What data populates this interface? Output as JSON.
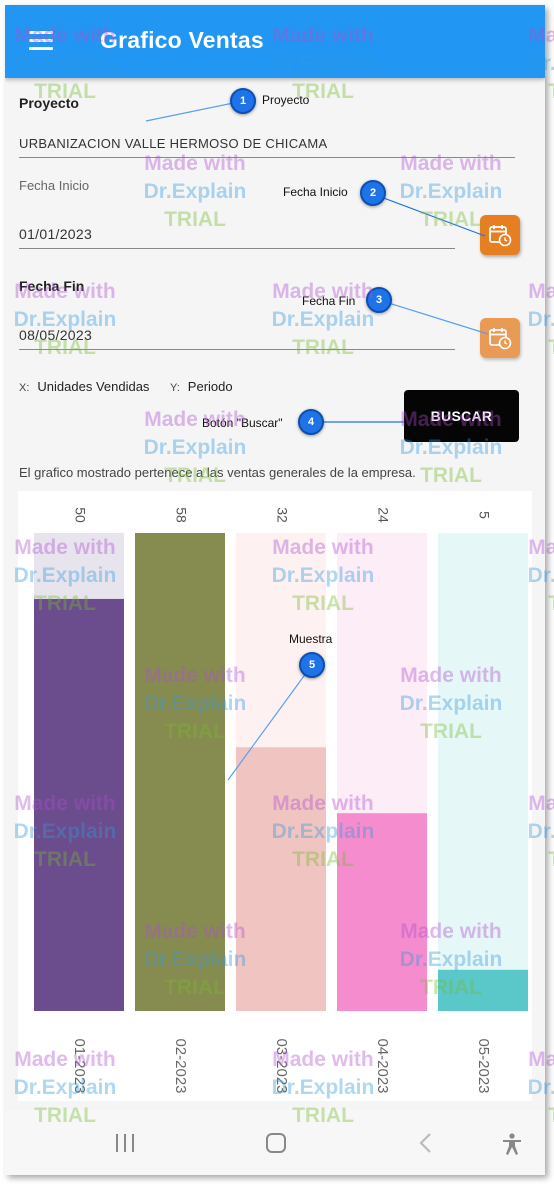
{
  "app": {
    "title": "Grafico Ventas"
  },
  "form": {
    "project_label": "Proyecto",
    "project_value": "URBANIZACION VALLE HERMOSO DE CHICAMA",
    "start_label": "Fecha Inicio",
    "start_value": "01/01/2023",
    "end_label": "Fecha Fin",
    "end_value": "08/05/2023",
    "x_mark": "X:",
    "x_value": "Unidades Vendidas",
    "y_mark": "Y:",
    "y_value": "Periodo",
    "search_label": "BUSCAR",
    "description": "El grafico mostrado pertenece a las ventas generales de la empresa."
  },
  "callouts": [
    {
      "number": "1",
      "text": "Proyecto"
    },
    {
      "number": "2",
      "text": "Fecha Inicio"
    },
    {
      "number": "3",
      "text": "Fecha Fin"
    },
    {
      "number": "4",
      "text": "Botón \"Buscar\""
    },
    {
      "number": "5",
      "text": "Muestra"
    }
  ],
  "watermark": {
    "line1": "Made with",
    "line2": "Dr.Explain",
    "line3": "TRIAL"
  },
  "icons": {
    "menu": "hamburger-menu-icon",
    "calendar": "calendar-clock-icon",
    "nav_recent": "recent-apps-icon",
    "nav_home": "home-icon",
    "nav_back": "back-icon",
    "nav_access": "accessibility-icon"
  },
  "colors": {
    "appbar": "#2196f3",
    "calendar_button": "#e67e22",
    "search_button": "#050505"
  },
  "chart_data": {
    "type": "bar",
    "categories": [
      "01-2023",
      "02-2023",
      "03-2023",
      "04-2023",
      "05-2023"
    ],
    "values": [
      50,
      58,
      32,
      24,
      5
    ],
    "ylim": [
      0,
      58
    ],
    "colors": [
      "#6b4c8c",
      "#868b4f",
      "#efc4c1",
      "#f48ccd",
      "#5ac7c8"
    ],
    "track_colors": [
      "#e8e4ee",
      "#eef0e2",
      "#fdf2f1",
      "#fdedf7",
      "#e6f7f7"
    ],
    "grid": false,
    "legend": "none"
  }
}
